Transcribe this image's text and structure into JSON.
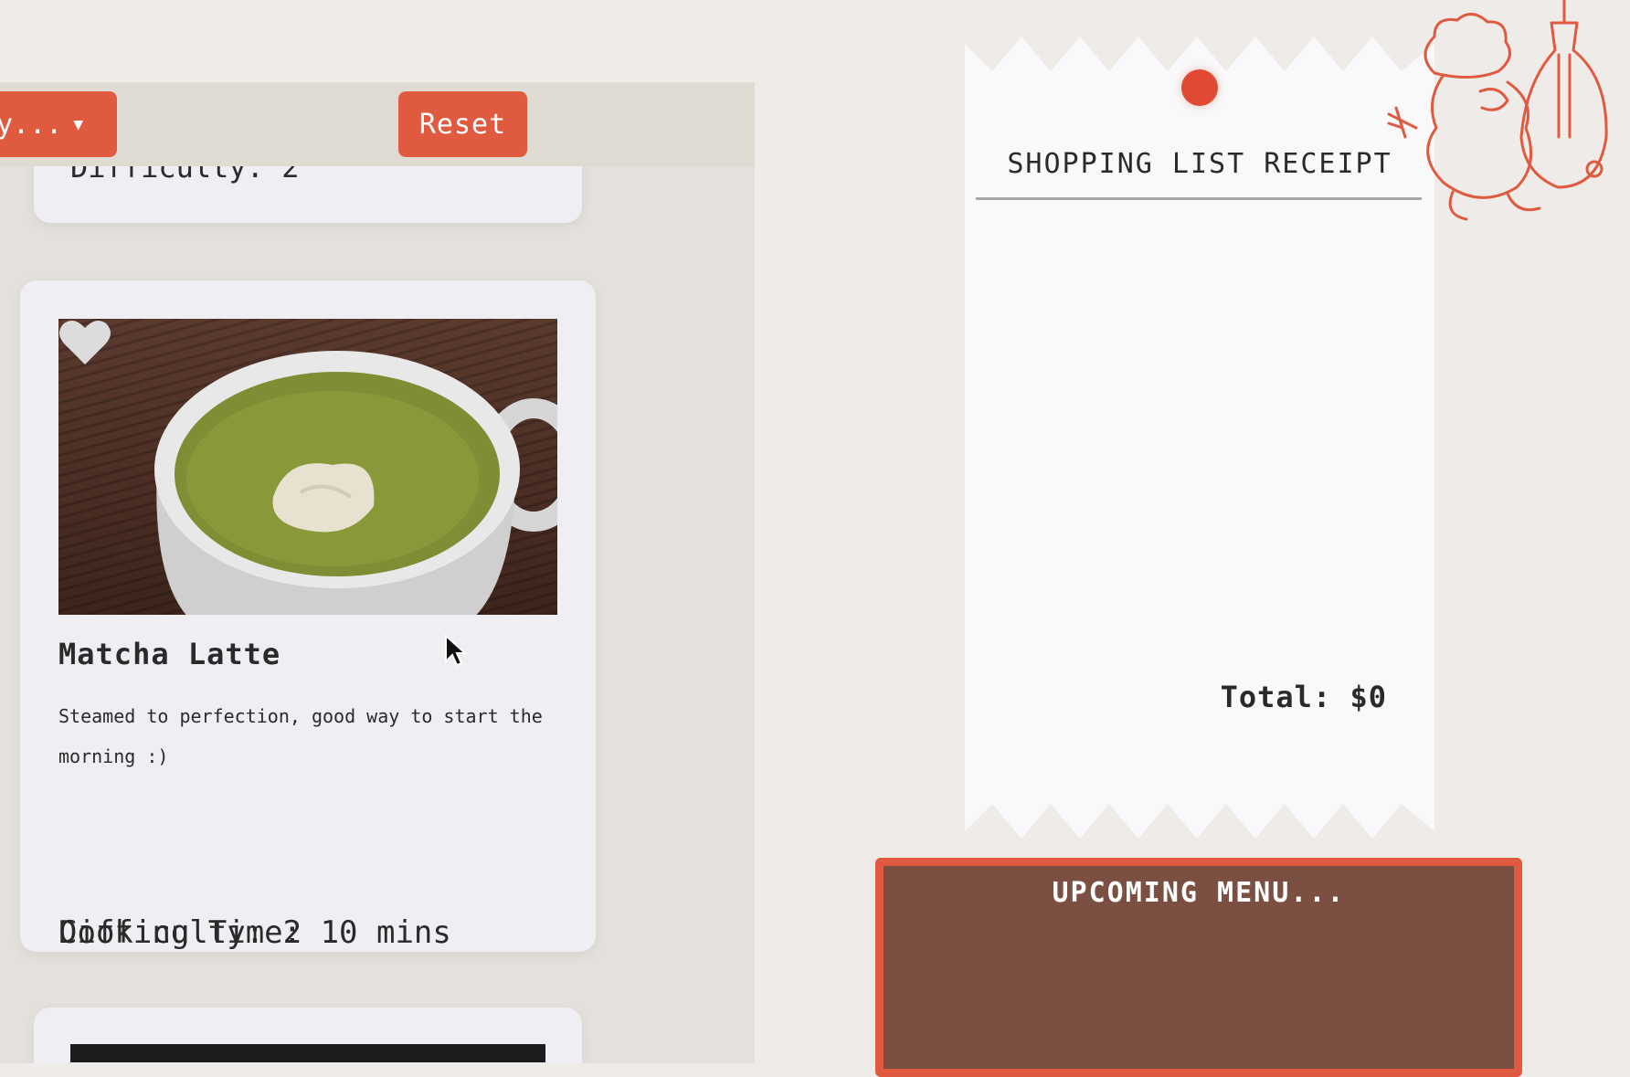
{
  "toolbar": {
    "sort_label": "y...",
    "reset_label": "Reset"
  },
  "cards": {
    "previous": {
      "difficulty": "Difficulty: 2"
    },
    "main": {
      "title": "Matcha Latte",
      "description": "Steamed to perfection, good way to start the morning :)",
      "cooking_time": "Cooking Time: 10 mins",
      "difficulty": "Difficulty: 2",
      "favorited": false
    }
  },
  "receipt": {
    "title": "SHOPPING LIST RECEIPT",
    "total": "Total: $0"
  },
  "menu_board": {
    "title": "UPCOMING MENU..."
  },
  "colors": {
    "accent": "#e05a40",
    "board": "#7b4f41",
    "paper": "#f9f9fb"
  },
  "icons": {
    "favorite": "heart-icon",
    "sort_caret": "caret-down-icon",
    "pin": "pin-icon",
    "decoration": "chef-rat-doodle"
  }
}
